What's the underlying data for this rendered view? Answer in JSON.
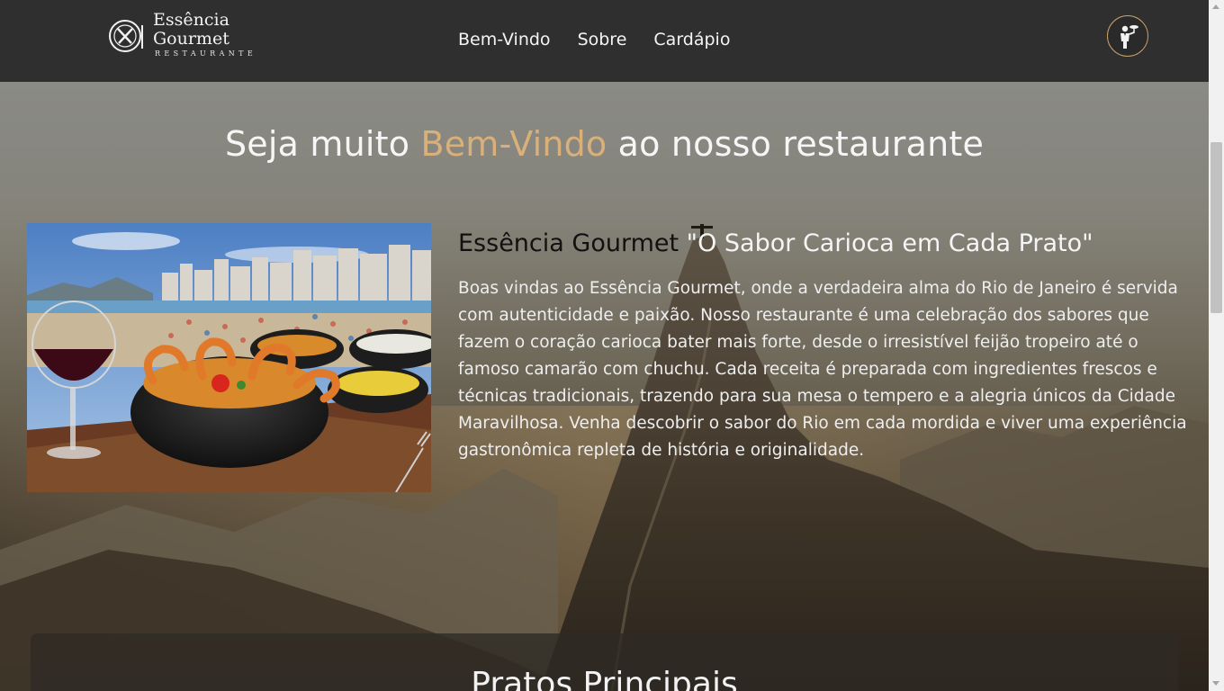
{
  "header": {
    "logo": {
      "name_line1": "Essência",
      "name_line2": "Gourmet",
      "subtitle": "RESTAURANTE",
      "icon": "cutlery-plate-icon"
    },
    "nav": [
      {
        "label": "Bem-Vindo"
      },
      {
        "label": "Sobre"
      },
      {
        "label": "Cardápio"
      }
    ],
    "waiter_icon": "waiter-icon",
    "accent_color": "#c9a26b"
  },
  "hero": {
    "headline_pre": "Seja muito ",
    "headline_accent": "Bem-Vindo",
    "headline_post": " ao nosso restaurante",
    "accent_color": "#d9b07a",
    "about": {
      "title": "Essência Gourmet",
      "tagline": " \"O Sabor Carioca em Cada Prato\"",
      "text": "Boas vindas ao Essência Gourmet, onde a verdadeira alma do Rio de Janeiro é servida com autenticidade e paixão. Nosso restaurante é uma celebração dos sabores que fazem o coração carioca bater mais forte, desde o irresistível feijão tropeiro até o famoso camarão com chuchu. Cada receita é preparada com ingredientes frescos e técnicas tradicionais, trazendo para sua mesa o tempero e a alegria únicos da Cidade Maravilhosa. Venha descobrir o sabor do Rio em cada mordida e viver uma experiência gastronômica repleta de história e originalidade."
    }
  },
  "menu_section": {
    "title": "Pratos Principais"
  }
}
